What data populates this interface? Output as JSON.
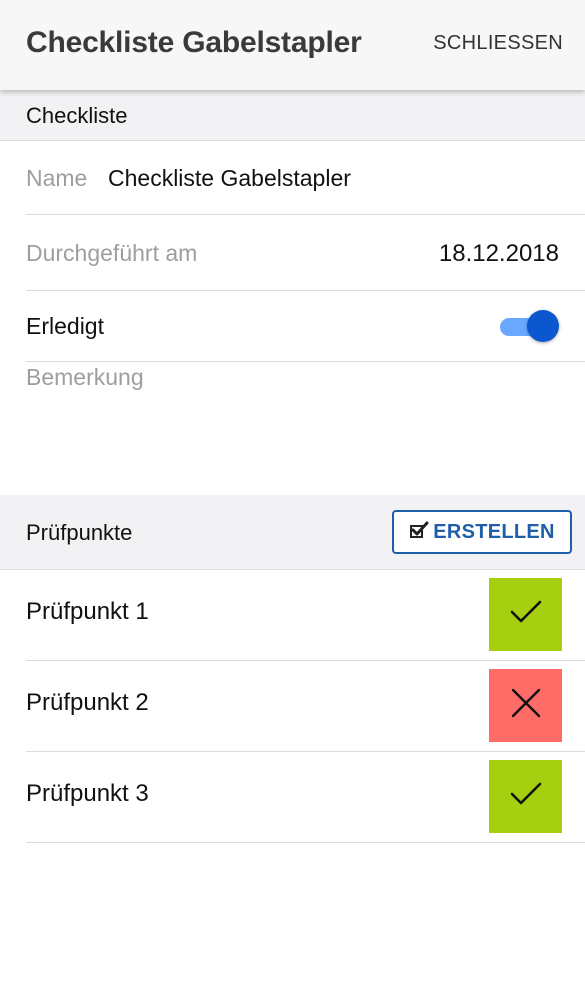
{
  "appbar": {
    "title": "Checkliste Gabelstapler",
    "close_label": "SCHLIESSEN"
  },
  "checklist_section": {
    "header": "Checkliste",
    "name_label": "Name",
    "name_value": "Checkliste Gabelstapler",
    "date_label": "Durchgeführt am",
    "date_value": "18.12.2018",
    "done_label": "Erledigt",
    "done_toggle_on": true,
    "remark_placeholder": "Bemerkung"
  },
  "checkpoints_section": {
    "header": "Prüfpunkte",
    "create_label": "ERSTELLEN",
    "create_icon": "checkbox-pen-icon",
    "items": [
      {
        "label": "Prüfpunkt 1",
        "status": "ok",
        "icon": "check-icon",
        "color": "#a4d00f"
      },
      {
        "label": "Prüfpunkt 2",
        "status": "failed",
        "icon": "x-icon",
        "color": "#ff6b66"
      },
      {
        "label": "Prüfpunkt 3",
        "status": "ok",
        "icon": "check-icon",
        "color": "#a4d00f"
      }
    ]
  },
  "colors": {
    "accent": "#1f5ea8",
    "toggle_thumb": "#0b57d0",
    "toggle_track": "#6aa8ff",
    "ok": "#a4d00f",
    "failed": "#ff6b66"
  }
}
